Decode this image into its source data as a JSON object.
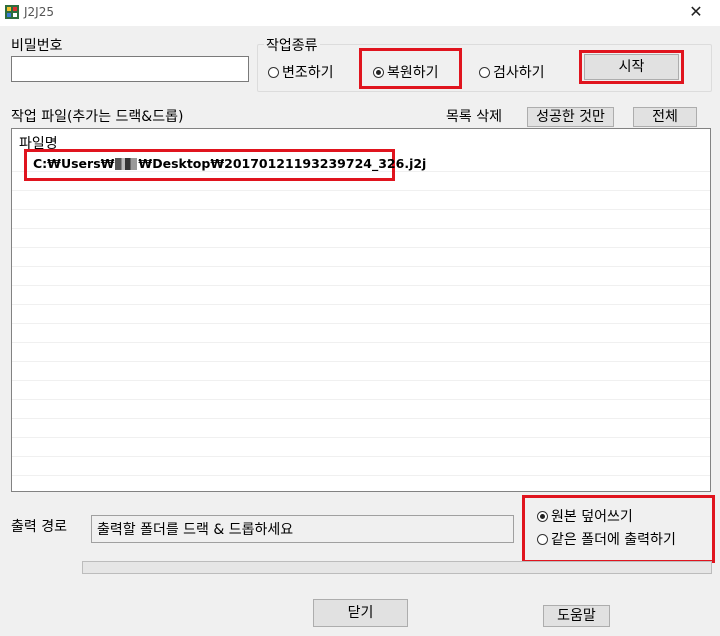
{
  "window": {
    "title": "J2J25",
    "close_glyph": "✕",
    "icon": "app-icon"
  },
  "password": {
    "label": "비밀번호",
    "value": ""
  },
  "task_type": {
    "label": "작업종류",
    "options": [
      {
        "label": "변조하기",
        "selected": false
      },
      {
        "label": "복원하기",
        "selected": true
      },
      {
        "label": "검사하기",
        "selected": false
      }
    ],
    "start_label": "시작"
  },
  "file_list": {
    "caption": "작업 파일(추가는 드랙&드롭)",
    "delete_label": "목록 삭제",
    "delete_success_label": "성공한 것만",
    "delete_all_label": "전체",
    "column_header": "파일명",
    "rows": [
      "C:₩Users₩[redacted]₩Desktop₩20170121193239724_326.j2j"
    ],
    "path_parts": {
      "prefix": "C:₩Users₩",
      "suffix": "₩Desktop₩20170121193239724_326.j2j"
    }
  },
  "output": {
    "label": "출력 경로",
    "placeholder": "출력할 폴더를 드랙 & 드롭하세요",
    "options": [
      {
        "label": "원본 덮어쓰기",
        "selected": true
      },
      {
        "label": "같은 폴더에 출력하기",
        "selected": false
      }
    ]
  },
  "footer": {
    "close_label": "닫기",
    "help_label": "도움말"
  },
  "colors": {
    "highlight": "#e0141e",
    "background": "#f0f0f0"
  }
}
